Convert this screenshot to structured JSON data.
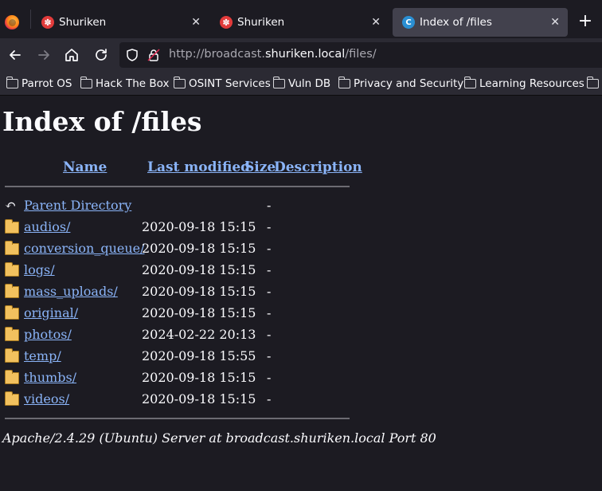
{
  "tabs": [
    {
      "title": "Shuriken",
      "favicon": "shuriken-favicon",
      "active": false
    },
    {
      "title": "Shuriken",
      "favicon": "shuriken-favicon",
      "active": false
    },
    {
      "title": "Index of /files",
      "favicon": "index-favicon",
      "active": true
    }
  ],
  "navbar": {
    "url_scheme": "http://broadcast.",
    "url_host": "shuriken.local",
    "url_path": "/files/"
  },
  "bookmarks": [
    {
      "label": "Parrot OS"
    },
    {
      "label": "Hack The Box"
    },
    {
      "label": "OSINT Services"
    },
    {
      "label": "Vuln DB"
    },
    {
      "label": "Privacy and Security"
    },
    {
      "label": "Learning Resources"
    }
  ],
  "page": {
    "heading": "Index of /files",
    "columns": {
      "name": "Name",
      "modified": "Last modified",
      "size": "Size",
      "description": "Description"
    },
    "parent": {
      "name": "Parent Directory",
      "size": "-"
    },
    "rows": [
      {
        "name": "audios/",
        "modified": "2020-09-18 15:15",
        "size": "-"
      },
      {
        "name": "conversion_queue/",
        "modified": "2020-09-18 15:15",
        "size": "-"
      },
      {
        "name": "logs/",
        "modified": "2020-09-18 15:15",
        "size": "-"
      },
      {
        "name": "mass_uploads/",
        "modified": "2020-09-18 15:15",
        "size": "-"
      },
      {
        "name": "original/",
        "modified": "2020-09-18 15:15",
        "size": "-"
      },
      {
        "name": "photos/",
        "modified": "2024-02-22 20:13",
        "size": "-"
      },
      {
        "name": "temp/",
        "modified": "2020-09-18 15:55",
        "size": "-"
      },
      {
        "name": "thumbs/",
        "modified": "2020-09-18 15:15",
        "size": "-"
      },
      {
        "name": "videos/",
        "modified": "2020-09-18 15:15",
        "size": "-"
      }
    ],
    "footer": "Apache/2.4.29 (Ubuntu) Server at broadcast.shuriken.local Port 80"
  }
}
